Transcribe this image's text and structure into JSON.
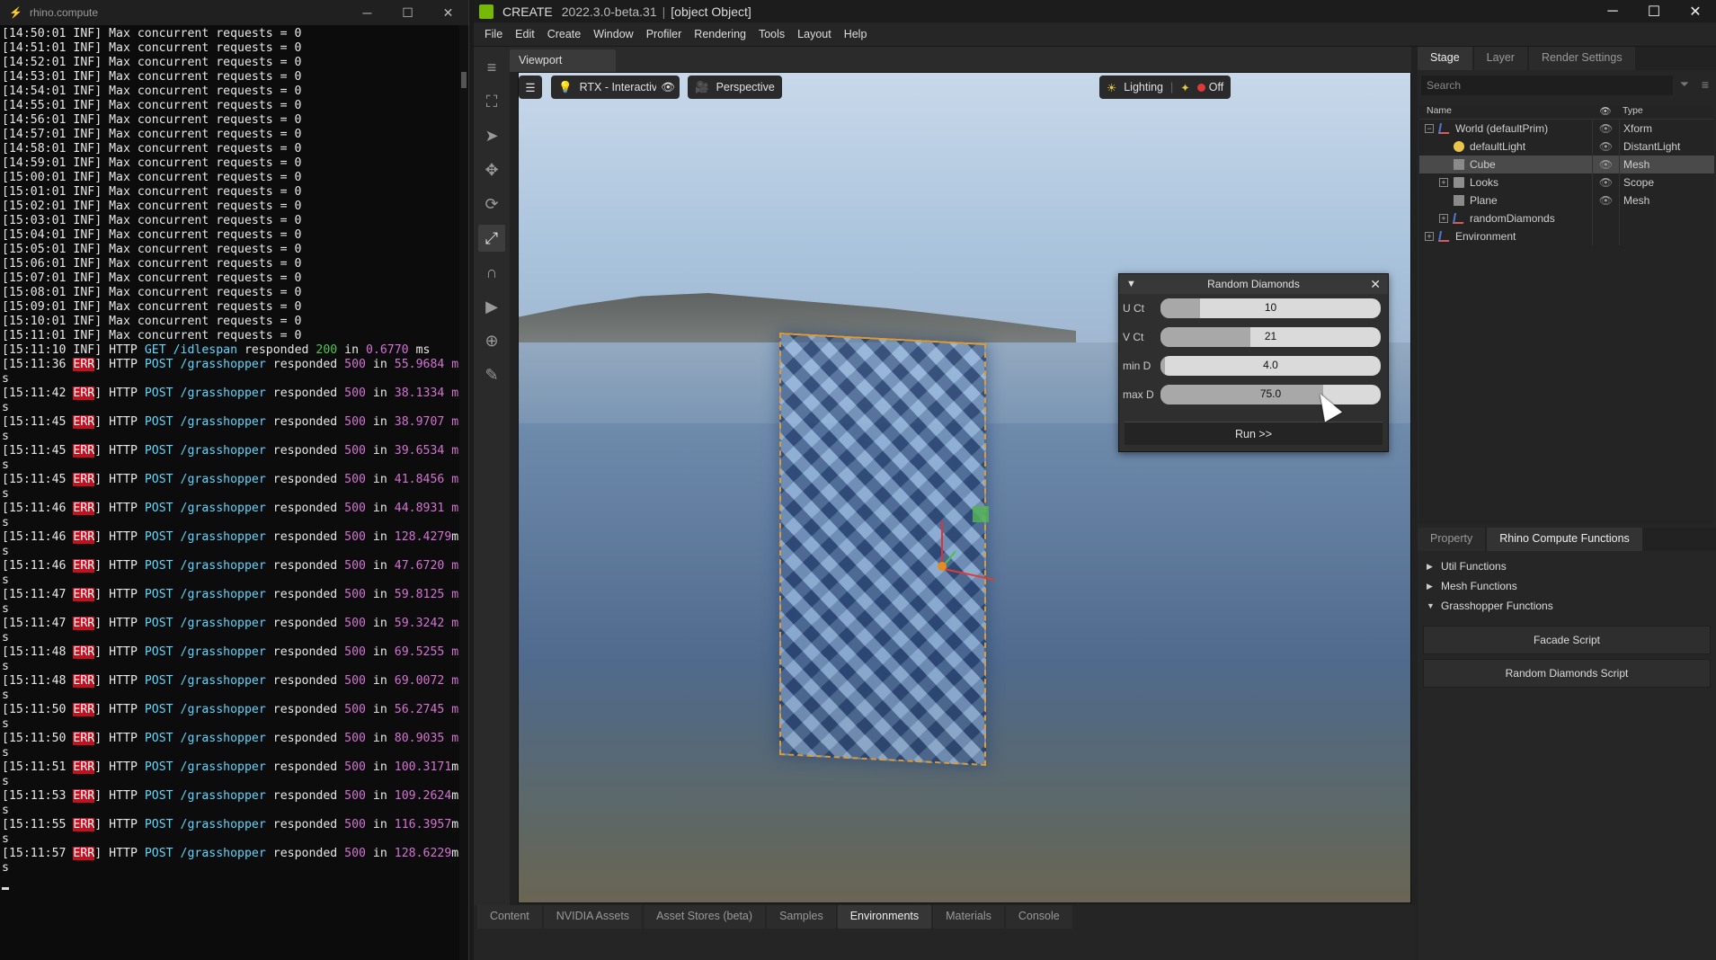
{
  "terminal": {
    "title": "rhino.compute",
    "lines": [
      {
        "ts": "[14:50:01",
        "lvl": "INF]",
        "msg": "Max concurrent requests = 0"
      },
      {
        "ts": "[14:51:01",
        "lvl": "INF]",
        "msg": "Max concurrent requests = 0"
      },
      {
        "ts": "[14:52:01",
        "lvl": "INF]",
        "msg": "Max concurrent requests = 0"
      },
      {
        "ts": "[14:53:01",
        "lvl": "INF]",
        "msg": "Max concurrent requests = 0"
      },
      {
        "ts": "[14:54:01",
        "lvl": "INF]",
        "msg": "Max concurrent requests = 0"
      },
      {
        "ts": "[14:55:01",
        "lvl": "INF]",
        "msg": "Max concurrent requests = 0"
      },
      {
        "ts": "[14:56:01",
        "lvl": "INF]",
        "msg": "Max concurrent requests = 0"
      },
      {
        "ts": "[14:57:01",
        "lvl": "INF]",
        "msg": "Max concurrent requests = 0"
      },
      {
        "ts": "[14:58:01",
        "lvl": "INF]",
        "msg": "Max concurrent requests = 0"
      },
      {
        "ts": "[14:59:01",
        "lvl": "INF]",
        "msg": "Max concurrent requests = 0"
      },
      {
        "ts": "[15:00:01",
        "lvl": "INF]",
        "msg": "Max concurrent requests = 0"
      },
      {
        "ts": "[15:01:01",
        "lvl": "INF]",
        "msg": "Max concurrent requests = 0"
      },
      {
        "ts": "[15:02:01",
        "lvl": "INF]",
        "msg": "Max concurrent requests = 0"
      },
      {
        "ts": "[15:03:01",
        "lvl": "INF]",
        "msg": "Max concurrent requests = 0"
      },
      {
        "ts": "[15:04:01",
        "lvl": "INF]",
        "msg": "Max concurrent requests = 0"
      },
      {
        "ts": "[15:05:01",
        "lvl": "INF]",
        "msg": "Max concurrent requests = 0"
      },
      {
        "ts": "[15:06:01",
        "lvl": "INF]",
        "msg": "Max concurrent requests = 0"
      },
      {
        "ts": "[15:07:01",
        "lvl": "INF]",
        "msg": "Max concurrent requests = 0"
      },
      {
        "ts": "[15:08:01",
        "lvl": "INF]",
        "msg": "Max concurrent requests = 0"
      },
      {
        "ts": "[15:09:01",
        "lvl": "INF]",
        "msg": "Max concurrent requests = 0"
      },
      {
        "ts": "[15:10:01",
        "lvl": "INF]",
        "msg": "Max concurrent requests = 0"
      },
      {
        "ts": "[15:11:01",
        "lvl": "INF]",
        "msg": "Max concurrent requests = 0"
      }
    ],
    "get_line": {
      "ts": "[15:11:10",
      "lvl": "INF]",
      "pre": "HTTP",
      "method": "GET",
      "path": "/idlespan",
      "mid": "responded",
      "code": "200",
      "in": "in",
      "time": "0.6770",
      "unit": "ms"
    },
    "err_lines": [
      {
        "ts": "[15:11:36",
        "time": "55.9684 m",
        "tail": "s"
      },
      {
        "ts": "[15:11:42",
        "time": "38.1334 m",
        "tail": "s"
      },
      {
        "ts": "[15:11:45",
        "time": "38.9707 m",
        "tail": "s"
      },
      {
        "ts": "[15:11:45",
        "time": "39.6534 m",
        "tail": "s"
      },
      {
        "ts": "[15:11:45",
        "time": "41.8456 m",
        "tail": "s"
      },
      {
        "ts": "[15:11:46",
        "time": "44.8931 m",
        "tail": "s"
      },
      {
        "ts": "[15:11:46",
        "time": "128.4279",
        "tail": "ms"
      },
      {
        "ts": "[15:11:46",
        "time": "47.6720 m",
        "tail": "s"
      },
      {
        "ts": "[15:11:47",
        "time": "59.8125 m",
        "tail": "s"
      },
      {
        "ts": "[15:11:47",
        "time": "59.3242 m",
        "tail": "s"
      },
      {
        "ts": "[15:11:48",
        "time": "69.5255 m",
        "tail": "s"
      },
      {
        "ts": "[15:11:48",
        "time": "69.0072 m",
        "tail": "s"
      },
      {
        "ts": "[15:11:50",
        "time": "56.2745 m",
        "tail": "s"
      },
      {
        "ts": "[15:11:50",
        "time": "80.9035 m",
        "tail": "s"
      },
      {
        "ts": "[15:11:51",
        "time": "100.3171",
        "tail": "ms"
      },
      {
        "ts": "[15:11:53",
        "time": "109.2624",
        "tail": "ms"
      },
      {
        "ts": "[15:11:55",
        "time": "116.3957",
        "tail": "ms"
      },
      {
        "ts": "[15:11:57",
        "time": "128.6229",
        "tail": "ms"
      }
    ],
    "err_tag": "ERR",
    "err_close": "]",
    "err_http": "HTTP",
    "err_method": "POST",
    "err_path": "/grasshopper",
    "err_resp": "responded",
    "err_code": "500",
    "err_in": "in"
  },
  "app": {
    "name": "CREATE",
    "version": "2022.3.0-beta.31",
    "separator": "|",
    "stage": {
      "tabs": [
        "Stage",
        "Layer",
        "Render Settings"
      ],
      "search_placeholder": "Search",
      "col_name": "Name",
      "col_type": "Type",
      "rows": [
        {
          "name": "World (defaultPrim)",
          "type": "Xform"
        },
        {
          "name": "defaultLight",
          "type": "DistantLight"
        },
        {
          "name": "Cube",
          "type": "Mesh"
        },
        {
          "name": "Looks",
          "type": "Scope"
        },
        {
          "name": "Plane",
          "type": "Mesh"
        },
        {
          "name": "randomDiamonds",
          "type": ""
        },
        {
          "name": "Environment",
          "type": ""
        }
      ]
    },
    "menu": [
      "File",
      "Edit",
      "Create",
      "Window",
      "Profiler",
      "Rendering",
      "Tools",
      "Layout",
      "Help"
    ],
    "viewport_tab": "Viewport",
    "toolbar": {
      "renderer": "RTX - Interactive",
      "camera": "Perspective",
      "lighting": "Lighting",
      "rec": "Off"
    },
    "dialog": {
      "title": "Random Diamonds",
      "rows": [
        {
          "label": "U Ct",
          "value": "10",
          "fill": 0.18
        },
        {
          "label": "V Ct",
          "value": "21",
          "fill": 0.41
        },
        {
          "label": "min D",
          "value": "4.0",
          "fill": 0.02
        },
        {
          "label": "max D",
          "value": "75.0",
          "fill": 0.74
        }
      ],
      "run": "Run >>"
    },
    "props": {
      "tabs": [
        "Property",
        "Rhino Compute Functions"
      ],
      "sections": [
        "Util Functions",
        "Mesh Functions",
        "Grasshopper Functions"
      ],
      "buttons": [
        "Facade Script",
        "Random Diamonds Script"
      ]
    },
    "bottom_tabs": [
      "Content",
      "NVIDIA Assets",
      "Asset Stores (beta)",
      "Samples",
      "Environments",
      "Materials",
      "Console"
    ]
  }
}
